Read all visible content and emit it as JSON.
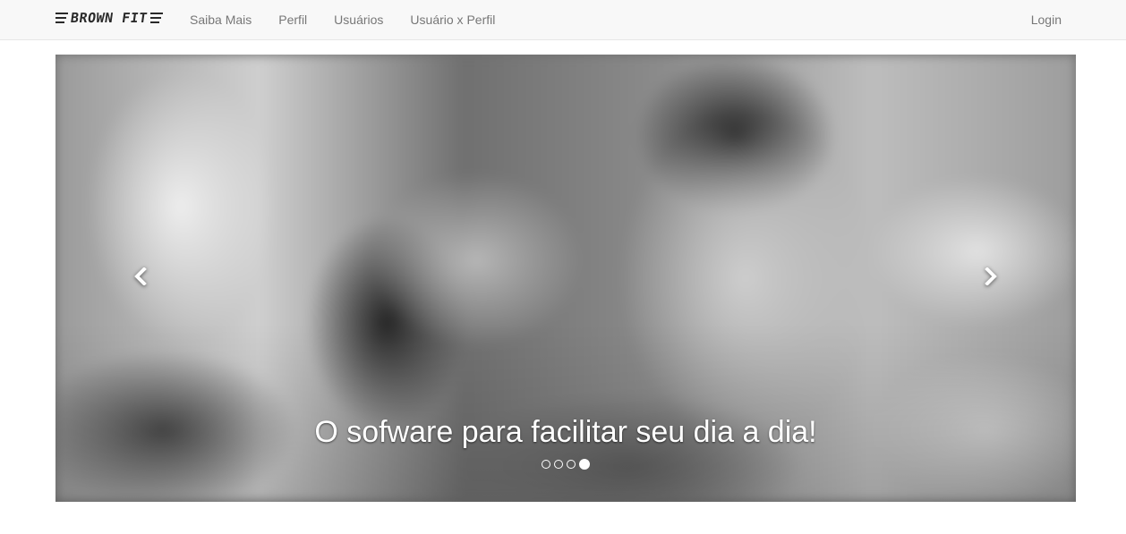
{
  "navbar": {
    "brand": "BROWN FIT",
    "links": [
      "Saiba Mais",
      "Perfil",
      "Usuários",
      "Usuário x Perfil"
    ],
    "login": "Login",
    "background": "#f8f8f8",
    "link_color": "#777777"
  },
  "carousel": {
    "caption": "O sofware para facilitar seu dia a dia!",
    "prev_icon": "chevron-left-icon",
    "next_icon": "chevron-right-icon",
    "indicators": {
      "count": 4,
      "active_index": 3
    }
  }
}
